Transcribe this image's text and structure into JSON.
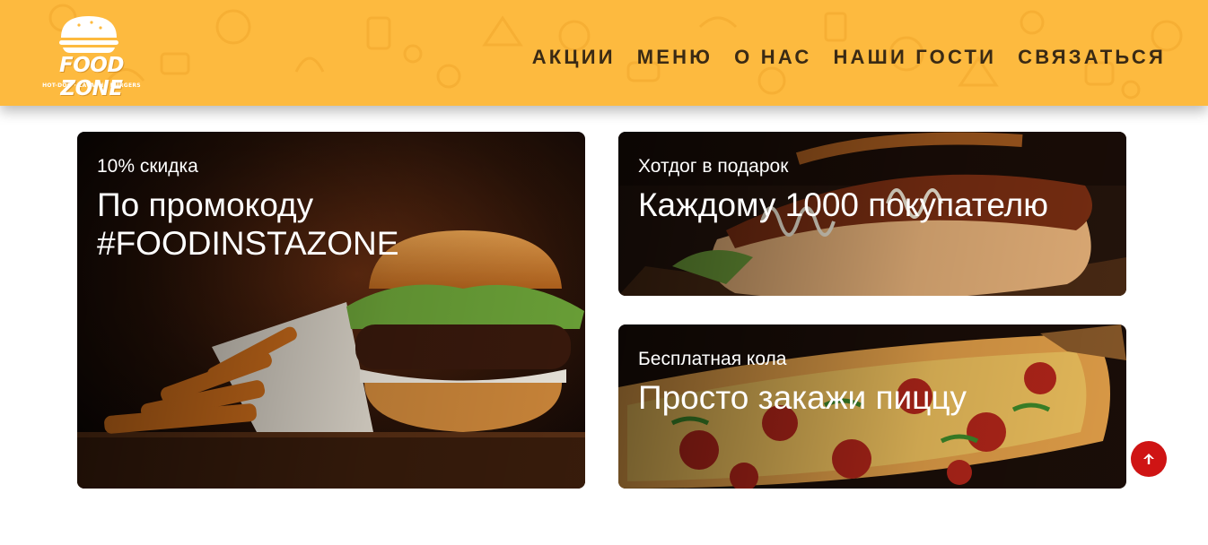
{
  "brand": {
    "name": "FOOD ZONE",
    "tagline": "HOT-DOG · LAVASH · BURGERS",
    "logo_icon": "burger-icon"
  },
  "nav": {
    "items": [
      {
        "label": "АКЦИИ"
      },
      {
        "label": "МЕНЮ"
      },
      {
        "label": "О НАС"
      },
      {
        "label": "НАШИ ГОСТИ"
      },
      {
        "label": "СВЯЗАТЬСЯ"
      }
    ]
  },
  "promos": [
    {
      "subtitle": "10% скидка",
      "title": "По промокоду #FOODINSTAZONE",
      "image": "burger-with-fries"
    },
    {
      "subtitle": "Хотдог в подарок",
      "title": "Каждому 1000 покупателю",
      "image": "hotdog"
    },
    {
      "subtitle": "Бесплатная кола",
      "title": "Просто закажи пиццу",
      "image": "pepperoni-pizza"
    }
  ],
  "scroll_top": {
    "icon": "arrow-up-icon"
  },
  "colors": {
    "header_bg": "#fdba3f",
    "nav_text": "#3a2a14",
    "scroll_button": "#cf1414",
    "card_text": "#ffffff"
  }
}
